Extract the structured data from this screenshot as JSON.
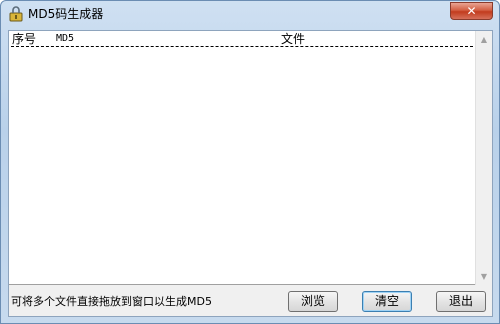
{
  "window": {
    "title": "MD5码生成器",
    "close_label": "✕"
  },
  "list": {
    "columns": {
      "seq": "序号",
      "md5": "MD5",
      "file": "文件"
    },
    "rows": []
  },
  "footer": {
    "hint": "可将多个文件直接拖放到窗口以生成MD5",
    "browse_label": "浏览",
    "clear_label": "清空",
    "exit_label": "退出"
  },
  "scrollbar": {
    "up_glyph": "▲",
    "down_glyph": "▼"
  }
}
